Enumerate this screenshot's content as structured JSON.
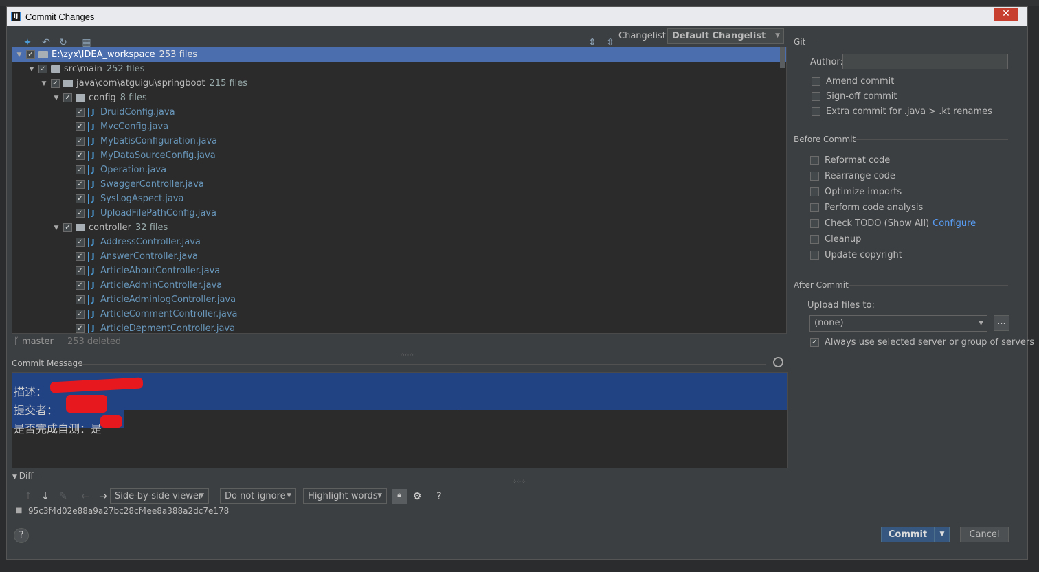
{
  "window": {
    "title": "Commit Changes",
    "close_label": "✕"
  },
  "toolbar": {
    "changelist_label": "Changelist:",
    "changelist_value": "Default Changelist"
  },
  "tree": {
    "rows": [
      {
        "label": "E:\\zyx\\IDEA_workspace",
        "count": "253 files"
      },
      {
        "label": "src\\main",
        "count": "252 files"
      },
      {
        "label": "java\\com\\atguigu\\springboot",
        "count": "215 files"
      },
      {
        "label": "config",
        "count": "8 files"
      },
      {
        "label": "DruidConfig.java"
      },
      {
        "label": "MvcConfig.java"
      },
      {
        "label": "MybatisConfiguration.java"
      },
      {
        "label": "MyDataSourceConfig.java"
      },
      {
        "label": "Operation.java"
      },
      {
        "label": "SwaggerController.java"
      },
      {
        "label": "SysLogAspect.java"
      },
      {
        "label": "UploadFilePathConfig.java"
      },
      {
        "label": "controller",
        "count": "32 files"
      },
      {
        "label": "AddressController.java"
      },
      {
        "label": "AnswerController.java"
      },
      {
        "label": "ArticleAboutController.java"
      },
      {
        "label": "ArticleAdminController.java"
      },
      {
        "label": "ArticleAdminlogController.java"
      },
      {
        "label": "ArticleCommentController.java"
      },
      {
        "label": "ArticleDepmentController.java"
      }
    ]
  },
  "branch": {
    "name": "master",
    "status": "253 deleted"
  },
  "commit_message": {
    "label": "Commit Message",
    "lines": [
      "描述：",
      "提交者：",
      "是否完成自测：是"
    ]
  },
  "git_panel": {
    "section_title": "Git",
    "author_label": "Author:",
    "author_value": "",
    "options": [
      "Amend commit",
      "Sign-off commit",
      "Extra commit for .java > .kt renames"
    ]
  },
  "before_commit": {
    "title": "Before Commit",
    "options": [
      "Reformat code",
      "Rearrange code",
      "Optimize imports",
      "Perform code analysis",
      "Check TODO (Show All)",
      "Cleanup",
      "Update copyright"
    ],
    "configure_link": "Configure"
  },
  "after_commit": {
    "title": "After Commit",
    "upload_label": "Upload files to:",
    "upload_value": "(none)",
    "ellipsis": "...",
    "always_use_label": "Always use selected server or group of servers"
  },
  "diff": {
    "label": "Diff",
    "viewer": "Side-by-side viewer",
    "ignore": "Do not ignore",
    "highlight": "Highlight words",
    "help": "?",
    "hash": "95c3f4d02e88a9a27bc28cf4ee8a388a2dc7e178"
  },
  "buttons": {
    "help": "?",
    "commit": "Commit",
    "cancel": "Cancel"
  }
}
